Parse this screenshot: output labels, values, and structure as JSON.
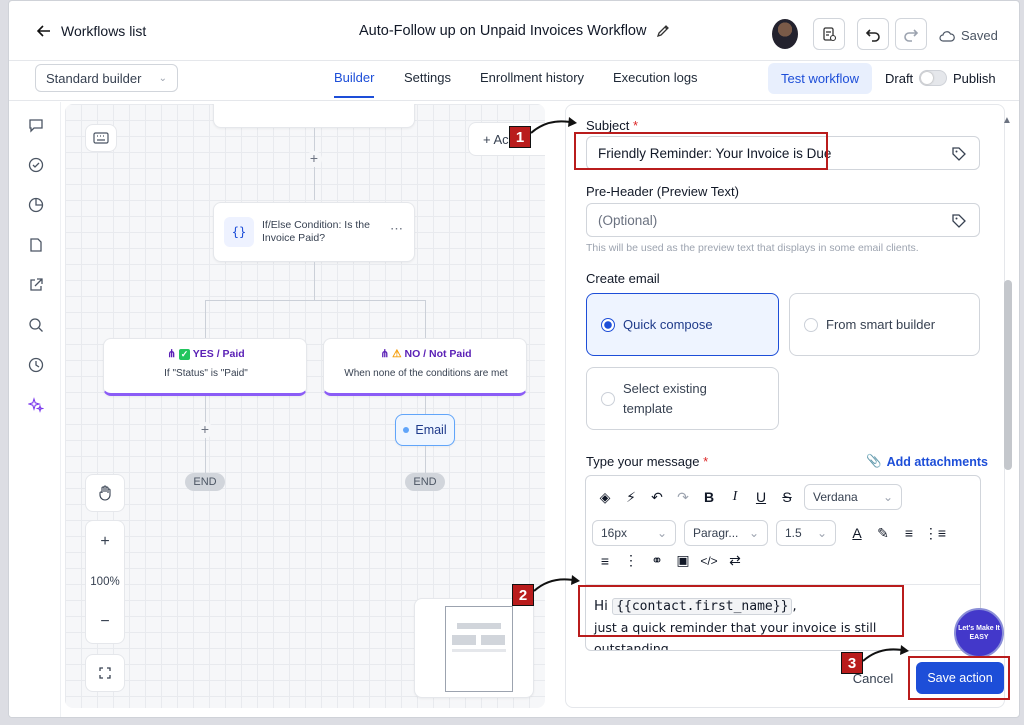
{
  "topbar": {
    "back_label": "Workflows list",
    "workflow_title": "Auto-Follow up on Unpaid Invoices Workflow",
    "saved_label": "Saved"
  },
  "subbar": {
    "builder_select": "Standard builder",
    "tabs": [
      {
        "label": "Builder",
        "active": true
      },
      {
        "label": "Settings"
      },
      {
        "label": "Enrollment history"
      },
      {
        "label": "Execution logs"
      }
    ],
    "test_button": "Test workflow",
    "draft_label": "Draft",
    "publish_label": "Publish"
  },
  "canvas": {
    "add_button": "+ Ac",
    "ifelse_node": {
      "title": "If/Else Condition: Is the Invoice Paid?",
      "icon": "{}"
    },
    "branch_yes": {
      "label": "YES / Paid",
      "condition": "If \"Status\" is \"Paid\""
    },
    "branch_no": {
      "label": "NO / Not Paid",
      "condition": "When none of the conditions are met"
    },
    "email_node": "Email",
    "end_label": "END",
    "zoom": "100%"
  },
  "panel": {
    "subject_label": "Subject",
    "subject_value": "Friendly Reminder: Your Invoice is Due",
    "preheader_label": "Pre-Header (Preview Text)",
    "preheader_placeholder": "(Optional)",
    "preheader_hint": "This will be used as the preview text that displays in some email clients.",
    "create_email_label": "Create email",
    "options": {
      "quick": "Quick compose",
      "smart": "From smart builder",
      "existing": "Select existing template"
    },
    "message_label": "Type your message",
    "attachments": "Add attachments",
    "font_family": "Verdana",
    "font_size": "16px",
    "paragraph": "Paragr...",
    "line_height": "1.5",
    "message_hi": "Hi",
    "message_token": "{{contact.first_name}}",
    "message_comma": ",",
    "message_line2": "just a quick reminder that your invoice is still",
    "message_line3": "outstanding.",
    "cancel": "Cancel",
    "save": "Save action"
  },
  "annotations": {
    "steps": [
      "1",
      "2",
      "3"
    ],
    "watermark": "Let's Make It EASY"
  },
  "colors": {
    "accent": "#1d4ed8",
    "annotation_red": "#b91c1c",
    "branch_purple": "#8b5cf6"
  }
}
